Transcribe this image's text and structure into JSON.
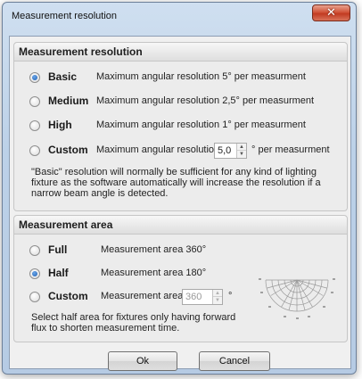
{
  "window": {
    "title": "Measurement resolution",
    "close_glyph": "✕"
  },
  "resolution": {
    "heading": "Measurement resolution",
    "options": [
      {
        "label": "Basic",
        "desc": "Maximum angular resolution 5° per measurment",
        "checked": true
      },
      {
        "label": "Medium",
        "desc": "Maximum angular resolution 2,5° per measurment",
        "checked": false
      },
      {
        "label": "High",
        "desc": "Maximum angular resolution 1° per measurment",
        "checked": false
      },
      {
        "label": "Custom",
        "desc": "Maximum angular resolution",
        "checked": false
      }
    ],
    "custom_value": "5,0",
    "custom_suffix": "° per measurment",
    "note_lines": [
      "\"Basic\" resolution will normally be sufficient for any kind of lighting",
      "fixture as the software automatically will increase the resolution if a",
      "narrow beam angle is detected."
    ]
  },
  "area": {
    "heading": "Measurement area",
    "options": [
      {
        "label": "Full",
        "desc": "Measurement area 360°",
        "checked": false
      },
      {
        "label": "Half",
        "desc": "Measurement area 180°",
        "checked": true
      },
      {
        "label": "Custom",
        "desc": "Measurement area",
        "checked": false
      }
    ],
    "custom_value": "360",
    "custom_suffix": "°",
    "note_lines": [
      "Select half area for fixtures only having forward",
      "flux to shorten measurement time."
    ]
  },
  "buttons": {
    "ok": "Ok",
    "cancel": "Cancel"
  },
  "icons": {
    "diagram": "polar-half-diagram-icon",
    "spin_up": "▲",
    "spin_down": "▼"
  }
}
